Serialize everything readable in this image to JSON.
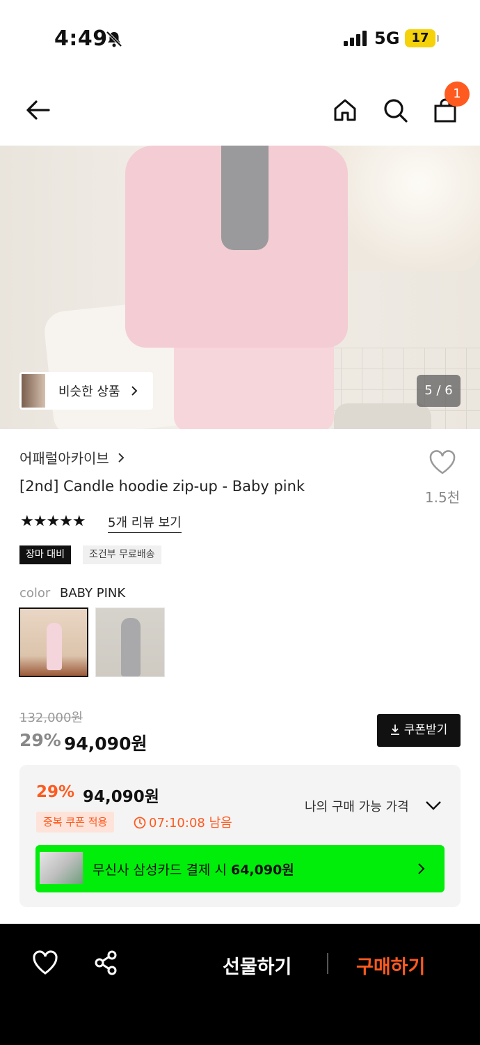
{
  "status_bar": {
    "time": "4:49",
    "network": "5G",
    "battery": "17",
    "icons": [
      "bell-slash-icon",
      "signal-icon"
    ]
  },
  "nav": {
    "icons": [
      "back-arrow-icon",
      "home-icon",
      "search-icon",
      "cart-icon"
    ],
    "cart_badge": "1"
  },
  "hero": {
    "similar_label": "비슷한 상품",
    "image_counter": "5 / 6"
  },
  "product": {
    "brand": "어패럴아카이브",
    "title": "[2nd] Candle hoodie zip-up - Baby pink",
    "likes": "1.5천",
    "stars": "★★★★★",
    "rating": 5,
    "review_link": "5개 리뷰 보기",
    "tags": [
      "장마 대비",
      "조건부 무료배송"
    ]
  },
  "color": {
    "label": "color",
    "value": "BABY PINK",
    "options": [
      "baby-pink",
      "grey"
    ]
  },
  "price": {
    "original": "132,000원",
    "discount": "29%",
    "final": "94,090원",
    "coupon_button": "쿠폰받기"
  },
  "my_price": {
    "discount": "29%",
    "final": "94,090원",
    "badge": "중복 쿠폰 적용",
    "timer": "07:10:08 남음",
    "toggle_label": "나의 구매 가능 가격",
    "card_text": "무신사 삼성카드 결제 시 ",
    "card_price": "64,090원"
  },
  "bottom_bar": {
    "gift": "선물하기",
    "buy": "구매하기"
  },
  "colors": {
    "accent": "#ff5a1f",
    "card_green": "#00ee0a",
    "black": "#111111"
  }
}
